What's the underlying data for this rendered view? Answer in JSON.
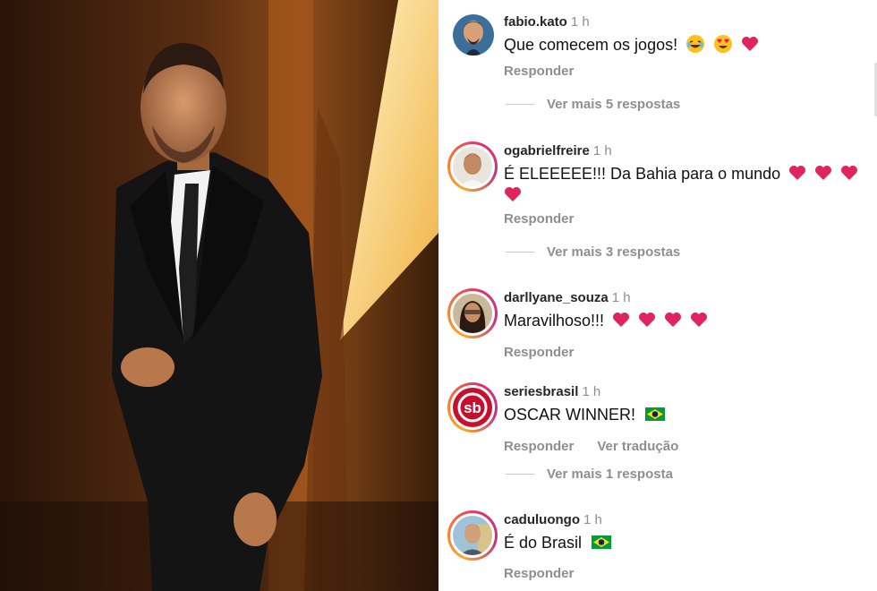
{
  "comments": [
    {
      "username": "fabio.kato",
      "time": "1 h",
      "text": "Que comecem os jogos!",
      "emojis": [
        "laughing-face-emoji",
        "heart-eyes-emoji",
        "red-heart-emoji"
      ],
      "reply_label": "Responder",
      "more_replies": "Ver mais 5 respostas"
    },
    {
      "username": "ogabrielfreire",
      "time": "1 h",
      "text": "É ELEEEEE!!! Da Bahia para o mundo",
      "emojis": [
        "red-heart-emoji",
        "red-heart-emoji",
        "red-heart-emoji",
        "red-heart-emoji"
      ],
      "reply_label": "Responder",
      "more_replies": "Ver mais 3 respostas"
    },
    {
      "username": "darllyane_souza",
      "time": "1 h",
      "text": "Maravilhoso!!!",
      "emojis": [
        "red-heart-emoji",
        "red-heart-emoji",
        "red-heart-emoji",
        "red-heart-emoji"
      ],
      "reply_label": "Responder"
    },
    {
      "username": "seriesbrasil",
      "time": "1 h",
      "text": "OSCAR WINNER!",
      "emojis": [
        "brazil-flag-emoji"
      ],
      "reply_label": "Responder",
      "translate_label": "Ver tradução",
      "more_replies": "Ver mais 1 resposta",
      "avatar_logo_text": "sb"
    },
    {
      "username": "caduluongo",
      "time": "1 h",
      "text": "É do Brasil",
      "emojis": [
        "brazil-flag-emoji"
      ],
      "reply_label": "Responder"
    }
  ],
  "colors": {
    "text": "#111111",
    "muted": "#8e8e8e",
    "heart": "#e0245e",
    "story_ring": [
      "#f9a825",
      "#f77737",
      "#e1306c",
      "#c13584"
    ],
    "logo_red": "#c8102e"
  }
}
